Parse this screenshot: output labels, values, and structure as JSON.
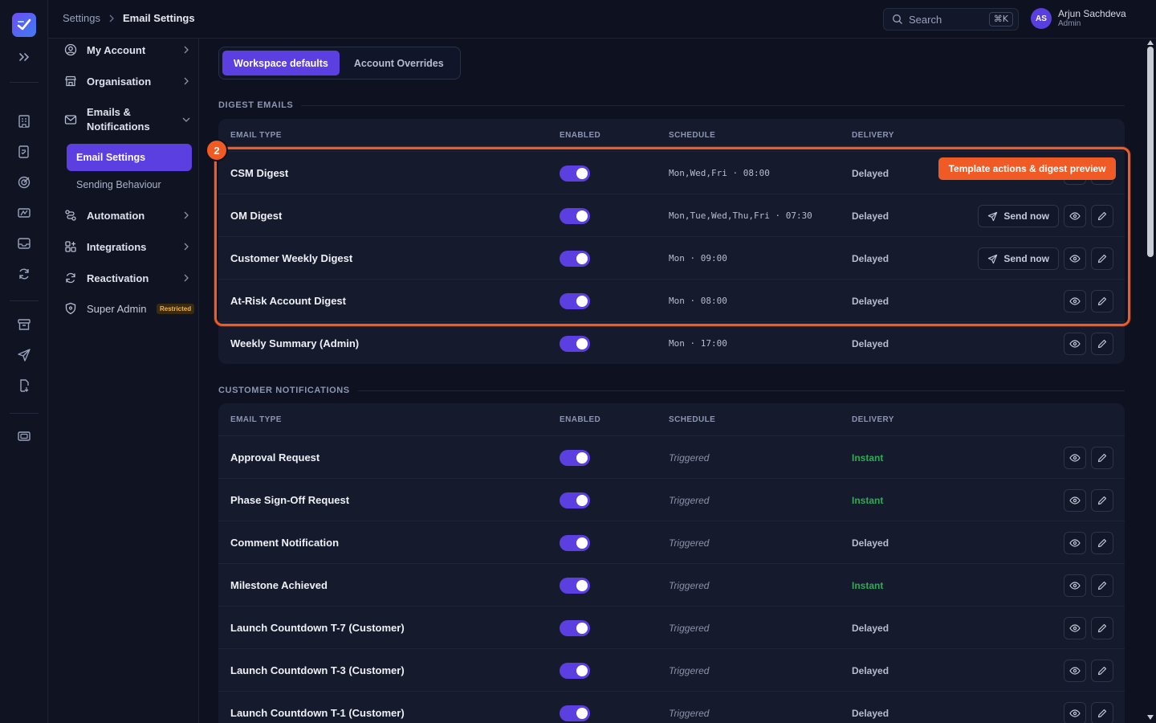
{
  "breadcrumb": {
    "parent": "Settings",
    "current": "Email Settings"
  },
  "search": {
    "placeholder": "Search",
    "shortcut": "⌘K"
  },
  "user": {
    "initials": "AS",
    "name": "Arjun Sachdeva",
    "role": "Admin"
  },
  "sidebar": {
    "items": [
      {
        "label": "My Account",
        "icon": "user-circle-icon"
      },
      {
        "label": "Organisation",
        "icon": "building-icon"
      },
      {
        "label": "Emails & Notifications",
        "icon": "mail-icon"
      },
      {
        "label": "Automation",
        "icon": "workflow-icon"
      },
      {
        "label": "Integrations",
        "icon": "grid-plus-icon"
      },
      {
        "label": "Reactivation",
        "icon": "refresh-icon"
      },
      {
        "label": "Super Admin",
        "icon": "shield-icon"
      }
    ],
    "sub_items": [
      {
        "label": "Email Settings",
        "active": true
      },
      {
        "label": "Sending Behaviour",
        "active": false
      }
    ],
    "restricted_badge": "Restricted"
  },
  "tabs": [
    {
      "label": "Workspace defaults",
      "active": true
    },
    {
      "label": "Account Overrides",
      "active": false
    }
  ],
  "columns": {
    "type": "EMAIL TYPE",
    "enabled": "ENABLED",
    "schedule": "SCHEDULE",
    "delivery": "DELIVERY"
  },
  "digest": {
    "title": "DIGEST EMAILS",
    "rows": [
      {
        "name": "CSM Digest",
        "enabled": true,
        "schedule": "Mon,Wed,Fri · 08:00",
        "delivery": "Delayed"
      },
      {
        "name": "OM Digest",
        "enabled": true,
        "schedule": "Mon,Tue,Wed,Thu,Fri · 07:30",
        "delivery": "Delayed",
        "send": "Send now"
      },
      {
        "name": "Customer Weekly Digest",
        "enabled": true,
        "schedule": "Mon · 09:00",
        "delivery": "Delayed",
        "send": "Send now"
      },
      {
        "name": "At-Risk Account Digest",
        "enabled": true,
        "schedule": "Mon · 08:00",
        "delivery": "Delayed"
      },
      {
        "name": "Weekly Summary (Admin)",
        "enabled": true,
        "schedule": "Mon · 17:00",
        "delivery": "Delayed"
      }
    ]
  },
  "customer": {
    "title": "CUSTOMER NOTIFICATIONS",
    "rows": [
      {
        "name": "Approval Request",
        "enabled": true,
        "schedule": "Triggered",
        "delivery": "Instant"
      },
      {
        "name": "Phase Sign-Off Request",
        "enabled": true,
        "schedule": "Triggered",
        "delivery": "Instant"
      },
      {
        "name": "Comment Notification",
        "enabled": true,
        "schedule": "Triggered",
        "delivery": "Delayed"
      },
      {
        "name": "Milestone Achieved",
        "enabled": true,
        "schedule": "Triggered",
        "delivery": "Instant"
      },
      {
        "name": "Launch Countdown T-7 (Customer)",
        "enabled": true,
        "schedule": "Triggered",
        "delivery": "Delayed"
      },
      {
        "name": "Launch Countdown T-3 (Customer)",
        "enabled": true,
        "schedule": "Triggered",
        "delivery": "Delayed"
      },
      {
        "name": "Launch Countdown T-1 (Customer)",
        "enabled": true,
        "schedule": "Triggered",
        "delivery": "Delayed"
      }
    ]
  },
  "callout": {
    "number": "2",
    "label": "Template actions & digest preview"
  },
  "colors": {
    "accent": "#5b3fe0",
    "highlight": "#f05a24",
    "instant": "#2eab57",
    "background": "#0d1120"
  }
}
